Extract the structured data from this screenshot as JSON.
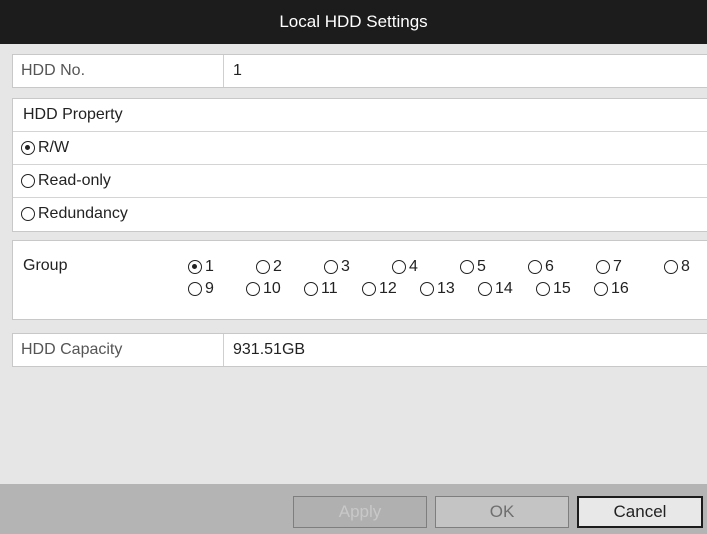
{
  "dialog": {
    "title": "Local HDD Settings"
  },
  "hdd_no": {
    "label": "HDD No.",
    "value": "1"
  },
  "hdd_property": {
    "label": "HDD Property",
    "options": [
      {
        "label": "R/W",
        "checked": true
      },
      {
        "label": "Read-only",
        "checked": false
      },
      {
        "label": "Redundancy",
        "checked": false
      }
    ]
  },
  "group": {
    "label": "Group",
    "options": [
      {
        "label": "1",
        "checked": true
      },
      {
        "label": "2",
        "checked": false
      },
      {
        "label": "3",
        "checked": false
      },
      {
        "label": "4",
        "checked": false
      },
      {
        "label": "5",
        "checked": false
      },
      {
        "label": "6",
        "checked": false
      },
      {
        "label": "7",
        "checked": false
      },
      {
        "label": "8",
        "checked": false
      },
      {
        "label": "9",
        "checked": false
      },
      {
        "label": "10",
        "checked": false
      },
      {
        "label": "11",
        "checked": false
      },
      {
        "label": "12",
        "checked": false
      },
      {
        "label": "13",
        "checked": false
      },
      {
        "label": "14",
        "checked": false
      },
      {
        "label": "15",
        "checked": false
      },
      {
        "label": "16",
        "checked": false
      }
    ]
  },
  "hdd_capacity": {
    "label": "HDD Capacity",
    "value": "931.51GB"
  },
  "buttons": {
    "apply": "Apply",
    "ok": "OK",
    "cancel": "Cancel"
  },
  "colors": {
    "titlebar": "#1c1c1c",
    "dialog_bg": "#e6e6e6",
    "footer_bg": "#b4b4b4"
  }
}
